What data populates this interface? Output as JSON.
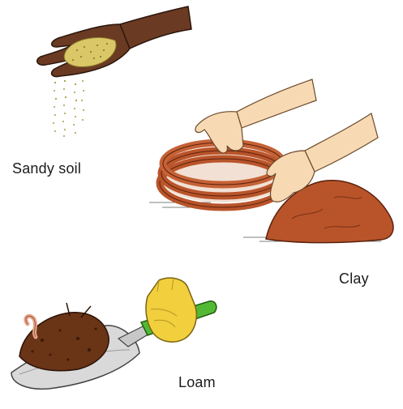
{
  "labels": {
    "sandy": "Sandy soil",
    "clay": "Clay",
    "loam": "Loam"
  },
  "colors": {
    "background": "#ffffff",
    "sand": "#d9c768",
    "skin_dark": "#6b3a22",
    "skin_light": "#f7d9b3",
    "clay": "#b9542a",
    "clay_dark": "#7a2f14",
    "loam": "#6a3417",
    "glove": "#f1cf3d",
    "handle": "#52b934",
    "metal": "#d9d9d9"
  },
  "icons": {
    "sandy": "hand-pouring-sand-icon",
    "clay": "hands-shaping-clay-icon",
    "loam": "trowel-with-loam-icon"
  }
}
